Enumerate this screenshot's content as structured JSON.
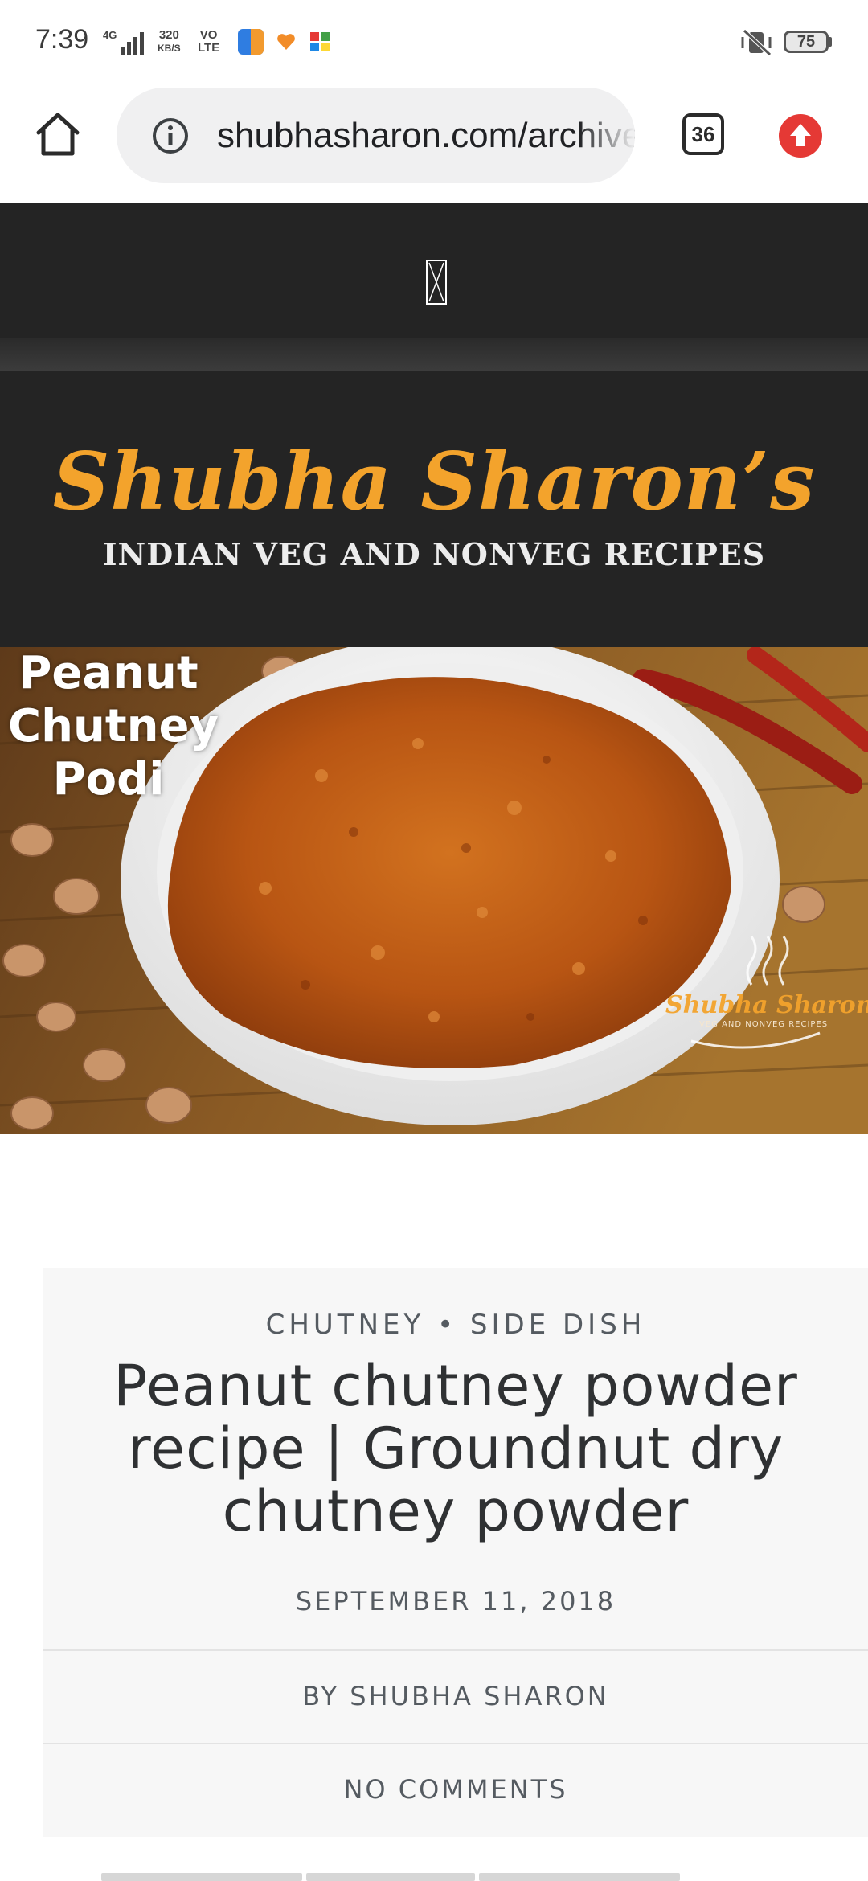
{
  "status_bar": {
    "time": "7:39",
    "network": "4G",
    "speed_value": "320",
    "speed_unit": "KB/S",
    "volte_top": "VO",
    "volte_bottom": "LTE",
    "battery": "75",
    "icons": [
      "signal-icon",
      "app-icon-blue",
      "app-icon-heart",
      "app-icon-puzzle",
      "vibrate-mute-icon",
      "battery-icon"
    ]
  },
  "browser": {
    "url": "shubhasharon.com/archives",
    "tab_count": "36",
    "icons": [
      "home-icon",
      "info-icon",
      "tabs-icon",
      "update-icon"
    ]
  },
  "site": {
    "title": "Shubha Sharon’s",
    "subtitle": "INDIAN VEG AND NONVEG RECIPES"
  },
  "hero": {
    "caption_lines": [
      "Peanut",
      "Chutney",
      "Podi"
    ],
    "watermark": "Shubha Sharon's",
    "watermark_sub": "VEG AND NONVEG RECIPES"
  },
  "post": {
    "categories": "CHUTNEY • SIDE DISH",
    "title": "Peanut chutney powder recipe | Groundnut dry chutney powder",
    "date": "SEPTEMBER 11, 2018",
    "author": "BY SHUBHA SHARON",
    "comments": "NO COMMENTS"
  },
  "colors": {
    "header_bg": "#242424",
    "brand_orange": "#f3a32c",
    "update_red": "#e53935",
    "card_bg": "#f7f7f7"
  }
}
